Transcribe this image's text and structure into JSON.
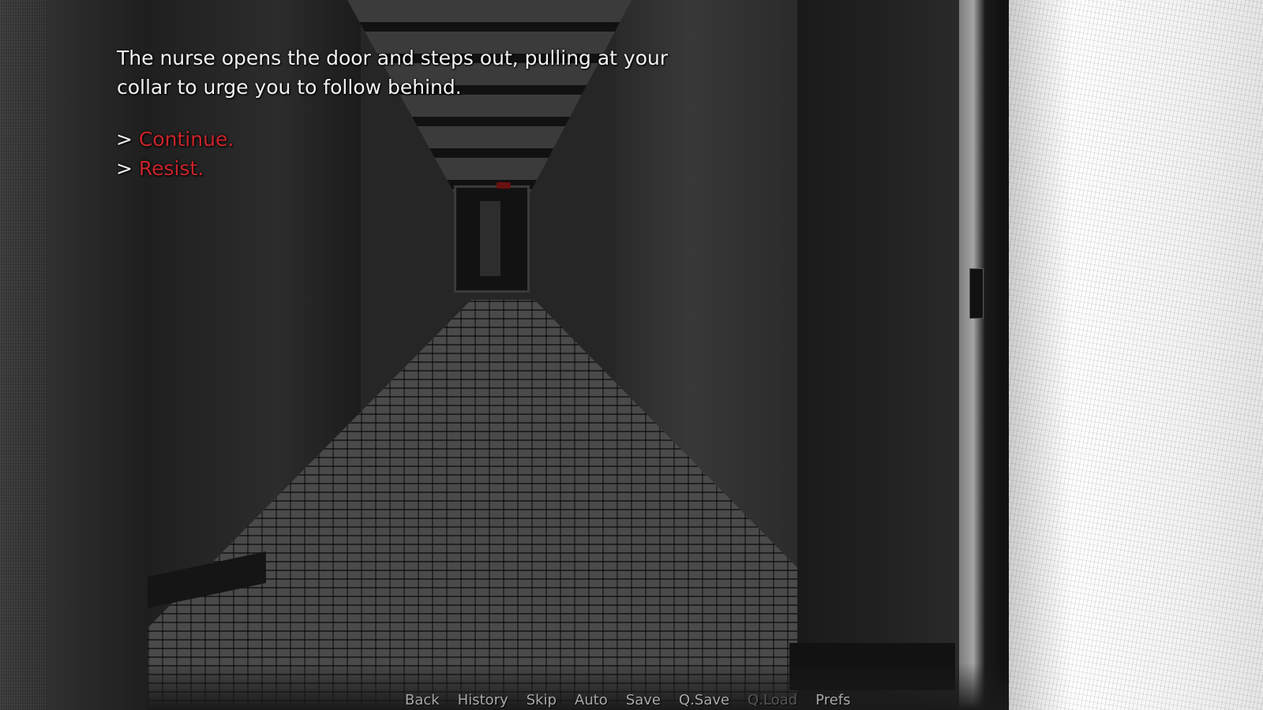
{
  "narration": {
    "text": "The nurse opens the door and steps out, pulling at your\ncollar to urge you to follow behind."
  },
  "choices": [
    {
      "prefix": ">",
      "label": "Continue."
    },
    {
      "prefix": ">",
      "label": "Resist."
    }
  ],
  "quick_menu": {
    "items": [
      {
        "label": "Back",
        "enabled": true
      },
      {
        "label": "History",
        "enabled": true
      },
      {
        "label": "Skip",
        "enabled": true
      },
      {
        "label": "Auto",
        "enabled": true
      },
      {
        "label": "Save",
        "enabled": true
      },
      {
        "label": "Q.Save",
        "enabled": true
      },
      {
        "label": "Q.Load",
        "enabled": false
      },
      {
        "label": "Prefs",
        "enabled": true
      }
    ]
  },
  "colors": {
    "choice_text": "#c8242a",
    "narration_text": "#f2f2f2",
    "menu_text": "#a9a9a9",
    "menu_disabled": "#555555"
  }
}
